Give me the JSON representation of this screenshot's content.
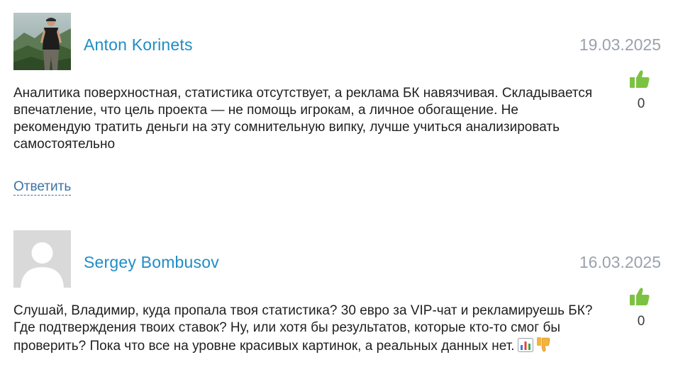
{
  "comments": [
    {
      "author": "Anton Korinets",
      "date": "19.03.2025",
      "avatar": "photo-avatar",
      "text": "Аналитика поверхностная, статистика отсутствует, а реклама БК навязчивая. Складывается впечатление, что цель проекта — не помощь игрокам, а личное обогащение. Не рекомендую тратить деньги на эту сомнительную випку, лучше учиться анализировать самостоятельно",
      "likes": "0",
      "reply_label": "Ответить"
    },
    {
      "author": "Sergey Bombusov",
      "date": "16.03.2025",
      "avatar": "default-avatar",
      "text": "Слушай, Владимир, куда пропала твоя статистика? 30 евро за VIP-чат и рекламируешь БК? Где подтверждения твоих ставок? Ну, или хотя бы результатов, которые кто-то смог бы проверить? Пока что все на уровне красивых картинок, а реальных данных нет.",
      "emojis": [
        "chart-emoji",
        "thumbs-down-emoji"
      ],
      "likes": "0"
    }
  ],
  "colors": {
    "author": "#1f8dc6",
    "date": "#9aa2ae",
    "like": "#7cc242",
    "reply": "#3b73a4",
    "avatar_placeholder": "#d9d9d9"
  }
}
